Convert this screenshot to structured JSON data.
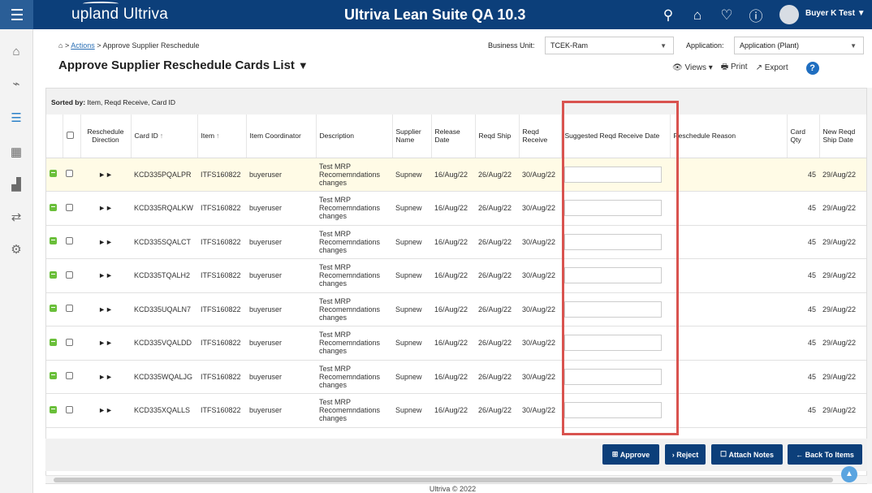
{
  "topbar": {
    "logo": "upland Ultriva",
    "app_title": "Ultriva Lean Suite QA 10.3",
    "user_name": "Buyer K Test ▼"
  },
  "breadcrumb": {
    "link": "Actions",
    "current": "Approve Supplier Reschedule"
  },
  "page_title": "Approve Supplier Reschedule Cards List",
  "business_unit": {
    "label": "Business Unit:",
    "value": "TCEK-Ram"
  },
  "application": {
    "label": "Application:",
    "value": "Application (Plant)"
  },
  "toolbar": {
    "views": "Views",
    "print": "Print",
    "export": "Export"
  },
  "sort_bar": {
    "label": "Sorted by:",
    "value": "Item, Reqd Receive, Card ID"
  },
  "columns": {
    "direction": "Reschedule Direction",
    "card_id": "Card ID",
    "item": "Item",
    "coordinator": "Item Coordinator",
    "description": "Description",
    "supplier": "Supplier Name",
    "release": "Release Date",
    "reqd_ship": "Reqd Ship",
    "reqd_receive": "Reqd Receive",
    "suggested": "Suggested Reqd Receive Date",
    "reason": "Reschedule Reason",
    "card_qty": "Card Qty",
    "new_ship": "New Reqd Ship Date"
  },
  "rows": [
    {
      "card_id": "KCD335PQALPR",
      "item": "ITFS160822",
      "coordinator": "buyeruser",
      "description": "Test MRP Recomemndations changes",
      "supplier": "Supnew",
      "release": "16/Aug/22",
      "reqd_ship": "26/Aug/22",
      "reqd_receive": "30/Aug/22",
      "qty": "45",
      "new_ship": "29/Aug/22"
    },
    {
      "card_id": "KCD335RQALKW",
      "item": "ITFS160822",
      "coordinator": "buyeruser",
      "description": "Test MRP Recomemndations changes",
      "supplier": "Supnew",
      "release": "16/Aug/22",
      "reqd_ship": "26/Aug/22",
      "reqd_receive": "30/Aug/22",
      "qty": "45",
      "new_ship": "29/Aug/22"
    },
    {
      "card_id": "KCD335SQALCT",
      "item": "ITFS160822",
      "coordinator": "buyeruser",
      "description": "Test MRP Recomemndations changes",
      "supplier": "Supnew",
      "release": "16/Aug/22",
      "reqd_ship": "26/Aug/22",
      "reqd_receive": "30/Aug/22",
      "qty": "45",
      "new_ship": "29/Aug/22"
    },
    {
      "card_id": "KCD335TQALH2",
      "item": "ITFS160822",
      "coordinator": "buyeruser",
      "description": "Test MRP Recomemndations changes",
      "supplier": "Supnew",
      "release": "16/Aug/22",
      "reqd_ship": "26/Aug/22",
      "reqd_receive": "30/Aug/22",
      "qty": "45",
      "new_ship": "29/Aug/22"
    },
    {
      "card_id": "KCD335UQALN7",
      "item": "ITFS160822",
      "coordinator": "buyeruser",
      "description": "Test MRP Recomemndations changes",
      "supplier": "Supnew",
      "release": "16/Aug/22",
      "reqd_ship": "26/Aug/22",
      "reqd_receive": "30/Aug/22",
      "qty": "45",
      "new_ship": "29/Aug/22"
    },
    {
      "card_id": "KCD335VQALDD",
      "item": "ITFS160822",
      "coordinator": "buyeruser",
      "description": "Test MRP Recomemndations changes",
      "supplier": "Supnew",
      "release": "16/Aug/22",
      "reqd_ship": "26/Aug/22",
      "reqd_receive": "30/Aug/22",
      "qty": "45",
      "new_ship": "29/Aug/22"
    },
    {
      "card_id": "KCD335WQALJG",
      "item": "ITFS160822",
      "coordinator": "buyeruser",
      "description": "Test MRP Recomemndations changes",
      "supplier": "Supnew",
      "release": "16/Aug/22",
      "reqd_ship": "26/Aug/22",
      "reqd_receive": "30/Aug/22",
      "qty": "45",
      "new_ship": "29/Aug/22"
    },
    {
      "card_id": "KCD335XQALLS",
      "item": "ITFS160822",
      "coordinator": "buyeruser",
      "description": "Test MRP Recomemndations changes",
      "supplier": "Supnew",
      "release": "16/Aug/22",
      "reqd_ship": "26/Aug/22",
      "reqd_receive": "30/Aug/22",
      "qty": "45",
      "new_ship": "29/Aug/22"
    }
  ],
  "buttons": {
    "approve": "Approve",
    "reject": "Reject",
    "attach_notes": "Attach Notes",
    "back": "Back To Items"
  },
  "footer": "Ultriva © 2022",
  "colors": {
    "brand": "#0c3f7a",
    "highlight": "#d9534f",
    "note_icon": "#6abf3a"
  }
}
